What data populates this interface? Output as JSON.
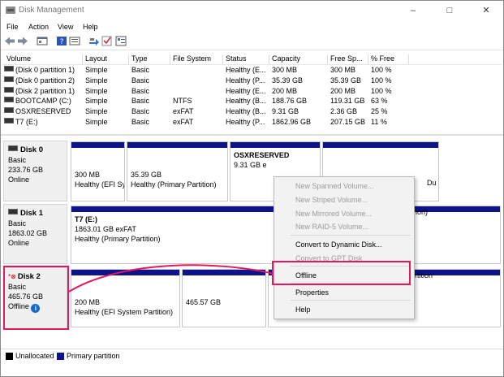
{
  "window": {
    "title": "Disk Management",
    "controls": {
      "minimize": "–",
      "maximize": "□",
      "close": "✕"
    }
  },
  "menu": [
    {
      "label": "File"
    },
    {
      "label": "Action"
    },
    {
      "label": "View"
    },
    {
      "label": "Help"
    }
  ],
  "volume_table": {
    "columns": [
      "Volume",
      "Layout",
      "Type",
      "File System",
      "Status",
      "Capacity",
      "Free Sp...",
      "% Free"
    ],
    "rows": [
      {
        "volume": "(Disk 0 partition 1)",
        "layout": "Simple",
        "type": "Basic",
        "fs": "",
        "status": "Healthy (E...",
        "capacity": "300 MB",
        "free": "300 MB",
        "pct": "100 %"
      },
      {
        "volume": "(Disk 0 partition 2)",
        "layout": "Simple",
        "type": "Basic",
        "fs": "",
        "status": "Healthy (P...",
        "capacity": "35.39 GB",
        "free": "35.39 GB",
        "pct": "100 %"
      },
      {
        "volume": "(Disk 2 partition 1)",
        "layout": "Simple",
        "type": "Basic",
        "fs": "",
        "status": "Healthy (E...",
        "capacity": "200 MB",
        "free": "200 MB",
        "pct": "100 %"
      },
      {
        "volume": "BOOTCAMP (C:)",
        "layout": "Simple",
        "type": "Basic",
        "fs": "NTFS",
        "status": "Healthy (B...",
        "capacity": "188.76 GB",
        "free": "119.31 GB",
        "pct": "63 %"
      },
      {
        "volume": "OSXRESERVED",
        "layout": "Simple",
        "type": "Basic",
        "fs": "exFAT",
        "status": "Healthy (B...",
        "capacity": "9.31 GB",
        "free": "2.36 GB",
        "pct": "25 %"
      },
      {
        "volume": "T7 (E:)",
        "layout": "Simple",
        "type": "Basic",
        "fs": "exFAT",
        "status": "Healthy (P...",
        "capacity": "1862.96 GB",
        "free": "207.15 GB",
        "pct": "11 %"
      }
    ]
  },
  "disks": [
    {
      "name": "Disk 0",
      "type": "Basic",
      "size": "233.76 GB",
      "state": "Online",
      "partitions": [
        {
          "line1": "300 MB",
          "line2": "Healthy (EFI Sy"
        },
        {
          "line1": "35.39 GB",
          "line2": "Healthy (Primary Partition)"
        },
        {
          "line0": "OSXRESERVED",
          "line1": "9.31 GB e",
          "line2": ""
        },
        {
          "line1": "",
          "line2": "Du"
        }
      ]
    },
    {
      "name": "Disk 1",
      "type": "Basic",
      "size": "1863.02 GB",
      "state": "Online",
      "partitions": [
        {
          "line0": "T7  (E:)",
          "line1": "1863.01 GB exFAT",
          "line2": "Healthy (Primary Partition)",
          "tail": "ion)"
        }
      ]
    },
    {
      "name": "Disk 2",
      "type": "Basic",
      "size": "465.76 GB",
      "state": "Offline",
      "partitions": [
        {
          "line1": "200 MB",
          "line2": "Healthy (EFI System Partition)"
        },
        {
          "line1": "465.57 GB",
          "line2": ""
        },
        {
          "tail": "rtition"
        }
      ]
    }
  ],
  "context_menu": {
    "items": [
      {
        "label": "New Spanned Volume...",
        "enabled": false
      },
      {
        "label": "New Striped Volume...",
        "enabled": false
      },
      {
        "label": "New Mirrored Volume...",
        "enabled": false
      },
      {
        "label": "New RAID-5 Volume...",
        "enabled": false
      },
      {
        "label": "Convert to Dynamic Disk...",
        "enabled": true
      },
      {
        "label": "Convert to GPT Disk",
        "enabled": false
      },
      {
        "label": "Offline",
        "enabled": true
      },
      {
        "label": "Properties",
        "enabled": true
      },
      {
        "label": "Help",
        "enabled": true
      }
    ]
  },
  "legend": [
    {
      "label": "Unallocated",
      "color": "#000000"
    },
    {
      "label": "Primary partition",
      "color": "#0f138a"
    }
  ],
  "colors": {
    "partition_bar": "#0f138a",
    "highlight": "#e3195b",
    "info": "#1669c7"
  }
}
